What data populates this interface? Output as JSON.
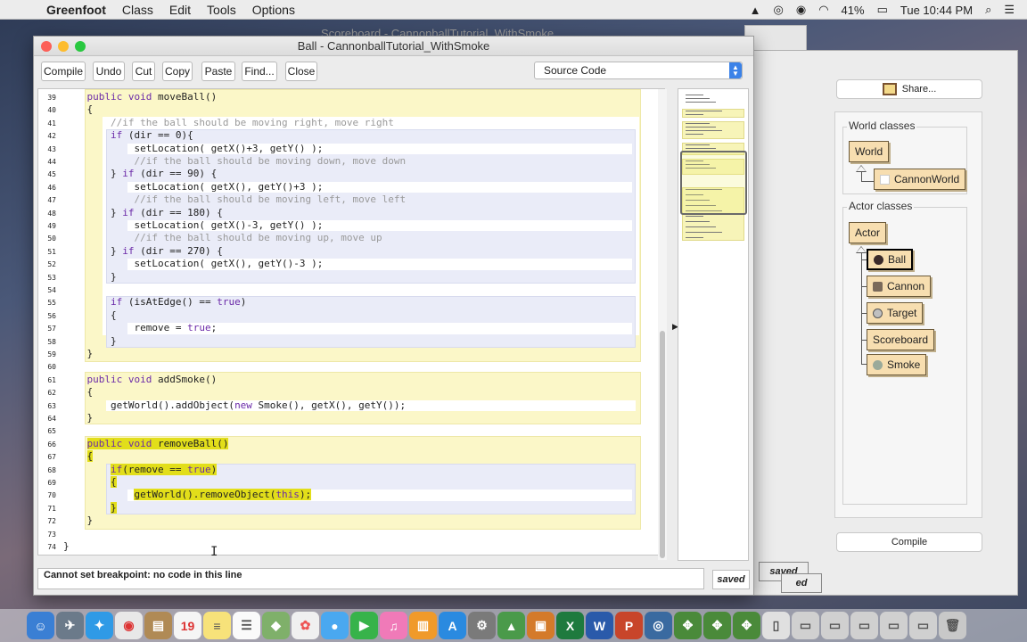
{
  "menubar": {
    "app": "Greenfoot",
    "items": [
      "Class",
      "Edit",
      "Tools",
      "Options"
    ],
    "battery": "41%",
    "clock": "Tue 10:44 PM"
  },
  "background_window_title": "Scoreboard - CannonballTutorial_WithSmoke",
  "editor": {
    "title": "Ball - CannonballTutorial_WithSmoke",
    "toolbar": [
      "Compile",
      "Undo",
      "Cut",
      "Copy",
      "Paste",
      "Find...",
      "Close"
    ],
    "view_select": "Source Code",
    "status": "Cannot set breakpoint: no code in this line",
    "saved_label": "saved",
    "code_lines": [
      {
        "n": 39,
        "text": "    public void moveBall()"
      },
      {
        "n": 40,
        "text": "    {"
      },
      {
        "n": 41,
        "text": "        //if the ball should be moving right, move right",
        "comment": true
      },
      {
        "n": 42,
        "text": "        if (dir == 0){"
      },
      {
        "n": 43,
        "text": "            setLocation( getX()+3, getY() );"
      },
      {
        "n": 44,
        "text": "            //if the ball should be moving down, move down",
        "comment": true
      },
      {
        "n": 45,
        "text": "        } if (dir == 90) {"
      },
      {
        "n": 46,
        "text": "            setLocation( getX(), getY()+3 );"
      },
      {
        "n": 47,
        "text": "            //if the ball should be moving left, move left",
        "comment": true
      },
      {
        "n": 48,
        "text": "        } if (dir == 180) {"
      },
      {
        "n": 49,
        "text": "            setLocation( getX()-3, getY() );"
      },
      {
        "n": 50,
        "text": "            //if the ball should be moving up, move up",
        "comment": true
      },
      {
        "n": 51,
        "text": "        } if (dir == 270) {"
      },
      {
        "n": 52,
        "text": "            setLocation( getX(), getY()-3 );"
      },
      {
        "n": 53,
        "text": "        }"
      },
      {
        "n": 54,
        "text": ""
      },
      {
        "n": 55,
        "text": "        if (isAtEdge() == true)"
      },
      {
        "n": 56,
        "text": "        {"
      },
      {
        "n": 57,
        "text": "            remove = true;"
      },
      {
        "n": 58,
        "text": "        }"
      },
      {
        "n": 59,
        "text": "    }"
      },
      {
        "n": 60,
        "text": ""
      },
      {
        "n": 61,
        "text": "    public void addSmoke()"
      },
      {
        "n": 62,
        "text": "    {"
      },
      {
        "n": 63,
        "text": "        getWorld().addObject(new Smoke(), getX(), getY());"
      },
      {
        "n": 64,
        "text": "    }"
      },
      {
        "n": 65,
        "text": ""
      },
      {
        "n": 66,
        "text": "    public void removeBall()",
        "selected": true
      },
      {
        "n": 67,
        "text": "    {",
        "selected": true
      },
      {
        "n": 68,
        "text": "        if(remove == true)",
        "selected": true
      },
      {
        "n": 69,
        "text": "        {",
        "selected": true
      },
      {
        "n": 70,
        "text": "            getWorld().removeObject(this);",
        "selected": true
      },
      {
        "n": 71,
        "text": "        }",
        "selected": true
      },
      {
        "n": 72,
        "text": "    }"
      },
      {
        "n": 73,
        "text": ""
      },
      {
        "n": 74,
        "text": "}"
      }
    ]
  },
  "greenfoot": {
    "share_label": "Share...",
    "world_classes_title": "World classes",
    "world": "World",
    "world_sub": "CannonWorld",
    "actor_classes_title": "Actor classes",
    "actor": "Actor",
    "actors": [
      {
        "name": "Ball",
        "icon_color": "#3a2a2a",
        "selected": true
      },
      {
        "name": "Cannon",
        "icon_color": "#7a6a5a"
      },
      {
        "name": "Target",
        "icon_color": "#c0c0c0"
      },
      {
        "name": "Scoreboard",
        "icon_color": ""
      },
      {
        "name": "Smoke",
        "icon_color": "#9aaa9a"
      }
    ],
    "compile_label": "Compile",
    "saved_label": "saved",
    "ed_label": "ed"
  },
  "colors": {
    "scope_yellow": "#fbf7c8",
    "scope_blue": "#eaecf8",
    "selection": "#e2de1a",
    "class_fill": "#f7deb0",
    "keyword": "#6b2aa8"
  }
}
